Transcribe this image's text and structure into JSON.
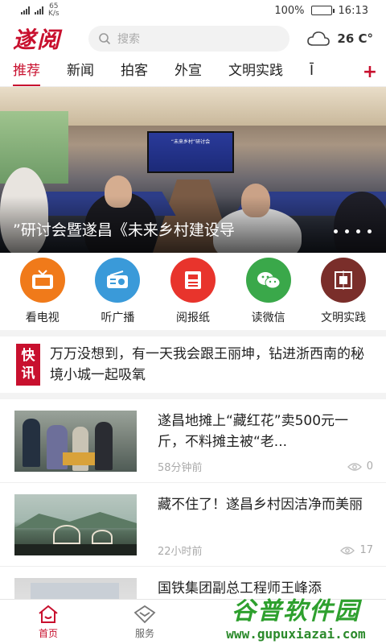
{
  "status": {
    "speed_value": "65",
    "speed_unit": "K/s",
    "battery": "100%",
    "battery_level": 1.0,
    "time": "16:13"
  },
  "header": {
    "logo": "遂阅",
    "search_placeholder": "搜索",
    "temperature": "26 C°"
  },
  "tabs": [
    {
      "label": "推荐"
    },
    {
      "label": "新闻"
    },
    {
      "label": "拍客"
    },
    {
      "label": "外宣"
    },
    {
      "label": "文明实践"
    },
    {
      "label": "Ī"
    }
  ],
  "hero": {
    "caption": "”研讨会暨遂昌《未来乡村建设导",
    "screen_text": "“未来乡村”研讨会"
  },
  "quicknav": [
    {
      "label": "看电视",
      "color": "#f07a1a",
      "icon": "tv-icon"
    },
    {
      "label": "听广播",
      "color": "#3a9ad9",
      "icon": "radio-icon"
    },
    {
      "label": "阅报纸",
      "color": "#e8342c",
      "icon": "newspaper-icon"
    },
    {
      "label": "读微信",
      "color": "#3aa84a",
      "icon": "wechat-icon"
    },
    {
      "label": "文明实践",
      "color": "#7a2e2a",
      "icon": "civilization-icon"
    }
  ],
  "flash": {
    "badge_top": "快",
    "badge_bottom": "讯",
    "text": "万万没想到，有一天我会跟王丽坤，钻进浙西南的秘境小城一起吸氧"
  },
  "news": [
    {
      "title": "遂昌地摊上“藏红花”卖500元一斤，不料摊主被“老...",
      "time": "58分钟前",
      "views": "0"
    },
    {
      "title": "藏不住了！遂昌乡村因洁净而美丽",
      "time": "22小时前",
      "views": "17"
    },
    {
      "title": "国铁集团副总工程师王峰添",
      "time": "",
      "views": ""
    }
  ],
  "bottomnav": [
    {
      "label": "首页"
    },
    {
      "label": "服务"
    }
  ],
  "watermark": {
    "big": "谷普软件园",
    "url": "www.gupuxiazai.com"
  }
}
